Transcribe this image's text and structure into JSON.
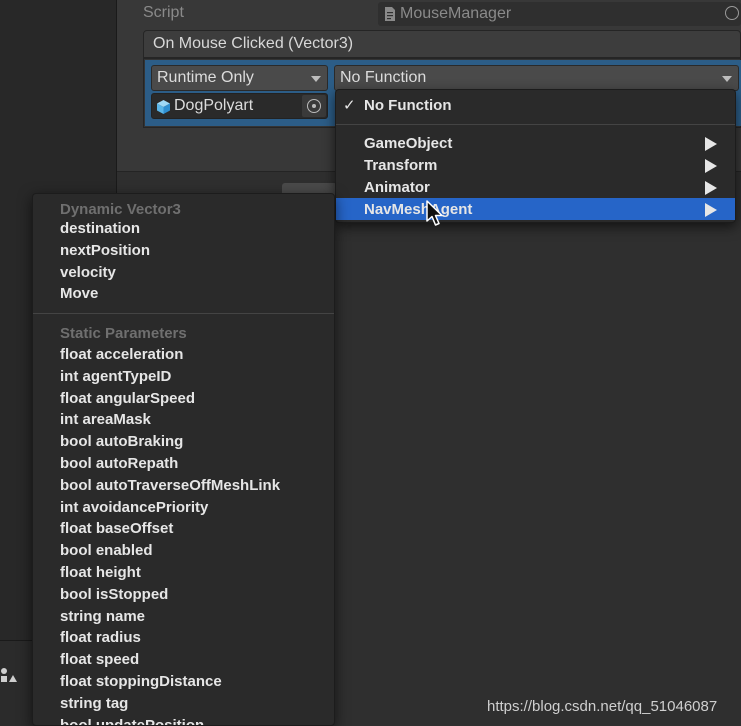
{
  "inspector": {
    "script_label": "Script",
    "script_value": "MouseManager",
    "event_title": "On Mouse Clicked (Vector3)",
    "runtime_option": "Runtime Only",
    "function_value": "No Function",
    "target_object": "DogPolyart"
  },
  "function_menu": {
    "items": [
      {
        "label": "No Function",
        "checked": true
      },
      {
        "label": "GameObject",
        "submenu": true
      },
      {
        "label": "Transform",
        "submenu": true
      },
      {
        "label": "Animator",
        "submenu": true
      },
      {
        "label": "NavMeshAgent",
        "submenu": true,
        "highlighted": true
      }
    ],
    "check_glyph": "✓"
  },
  "navmesh_menu": {
    "dynamic_header": "Dynamic Vector3",
    "dynamic_items": [
      "destination",
      "nextPosition",
      "velocity",
      "Move"
    ],
    "static_header": "Static Parameters",
    "static_items": [
      "float acceleration",
      "int agentTypeID",
      "float angularSpeed",
      "int areaMask",
      "bool autoBraking",
      "bool autoRepath",
      "bool autoTraverseOffMeshLink",
      "int avoidancePriority",
      "float baseOffset",
      "bool enabled",
      "float height",
      "bool isStopped",
      "string name",
      "float radius",
      "float speed",
      "float stoppingDistance",
      "string tag",
      "bool updatePosition"
    ]
  },
  "watermark": "https://blog.csdn.net/qq_51046087",
  "colors": {
    "selection": "#2665c8",
    "listener_row": "#2c5d87",
    "menu_bg": "#2a2a2a"
  },
  "icons": [
    "document-icon",
    "object-picker-icon",
    "cube-icon",
    "submenu-arrow-icon",
    "mouse-cursor-icon",
    "checkmark-icon"
  ]
}
